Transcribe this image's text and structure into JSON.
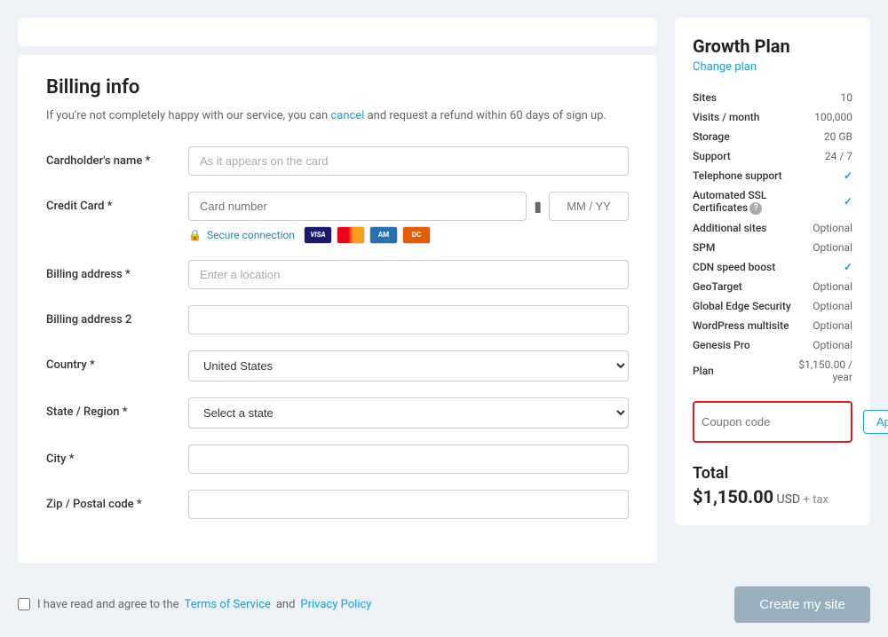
{
  "page": {
    "background_color": "#eef2f7"
  },
  "billing_info": {
    "title": "Billing info",
    "subtitle": "If you're not completely happy with our service, you can cancel and request a refund within 60 days of sign up.",
    "cancel_link": "cancel",
    "fields": {
      "cardholder_label": "Cardholder's name *",
      "cardholder_placeholder": "As it appears on the card",
      "credit_card_label": "Credit Card *",
      "cc_number_placeholder": "Card number",
      "cc_expiry_placeholder": "MM / YY",
      "secure_connection": "Secure connection",
      "billing_address_label": "Billing address *",
      "billing_address_placeholder": "Enter a location",
      "billing_address2_label": "Billing address 2",
      "country_label": "Country *",
      "country_value": "United States",
      "state_label": "State / Region *",
      "state_placeholder": "Select a state",
      "city_label": "City *",
      "zip_label": "Zip / Postal code *"
    }
  },
  "plan": {
    "title": "Growth Plan",
    "change_plan_label": "Change plan",
    "features": [
      {
        "name": "Sites",
        "value": "10"
      },
      {
        "name": "Visits / month",
        "value": "100,000"
      },
      {
        "name": "Storage",
        "value": "20 GB"
      },
      {
        "name": "Support",
        "value": "24 / 7"
      },
      {
        "name": "Telephone support",
        "value": "check"
      },
      {
        "name": "Automated SSL Certificates",
        "value": "check",
        "has_info": true
      },
      {
        "name": "Additional sites",
        "value": "Optional"
      },
      {
        "name": "SPM",
        "value": "Optional"
      },
      {
        "name": "CDN speed boost",
        "value": "check"
      },
      {
        "name": "GeoTarget",
        "value": "Optional"
      },
      {
        "name": "Global Edge Security",
        "value": "Optional"
      },
      {
        "name": "WordPress multisite",
        "value": "Optional"
      },
      {
        "name": "Genesis Pro",
        "value": "Optional"
      },
      {
        "name": "Plan",
        "value": "$1,150.00 / year"
      }
    ],
    "coupon_placeholder": "Coupon code",
    "apply_button": "Apply",
    "total_label": "Total",
    "total_amount": "$1,150.00",
    "total_currency": "USD",
    "total_tax": "+ tax"
  },
  "bottom_bar": {
    "terms_prefix": "I have read and agree to the",
    "terms_link": "Terms of Service",
    "terms_and": "and",
    "privacy_link": "Privacy Policy",
    "create_button": "Create my site"
  }
}
